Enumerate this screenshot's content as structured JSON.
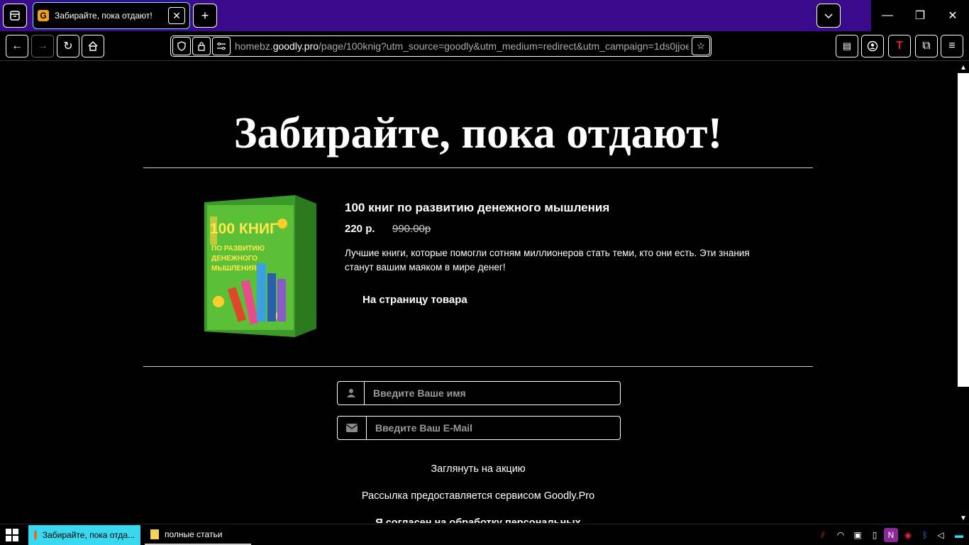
{
  "browser": {
    "tab_title": "Забирайте, пока отдают!",
    "tab_favicon_letter": "G",
    "url_prefix": "homebz.",
    "url_domain": "goodly.pro",
    "url_rest": "/page/100knig?utm_source=goodly&utm_medium=redirect&utm_campaign=1ds0jjoe",
    "accent_color": "#3a0a8c"
  },
  "page": {
    "headline": "Забирайте, пока отдают!",
    "product": {
      "title": "100 книг по развитию денежного мышления",
      "price": "220 р.",
      "old_price": "990.00р",
      "description": "Лучшие книги, которые помогли сотням миллионеров стать теми, кто они есть. Эти знания станут вашим маяком в мире денег!",
      "link_label": "На страницу товара",
      "cover_title": "100 КНИГ",
      "cover_subtitle_1": "ПО РАЗВИТИЮ",
      "cover_subtitle_2": "ДЕНЕЖНОГО",
      "cover_subtitle_3": "МЫШЛЕНИЯ"
    },
    "form": {
      "name_placeholder": "Введите Ваше имя",
      "email_placeholder": "Введите Ваш E-Mail",
      "promo_link": "Заглянуть на акцию",
      "service_note": "Рассылка предоставляется сервисом Goodly.Pro",
      "consent_text": "Я согласен на обработку персональных"
    }
  },
  "taskbar": {
    "items": [
      {
        "label": "Забирайте, пока отда..."
      },
      {
        "label": "полные статьи"
      }
    ]
  }
}
